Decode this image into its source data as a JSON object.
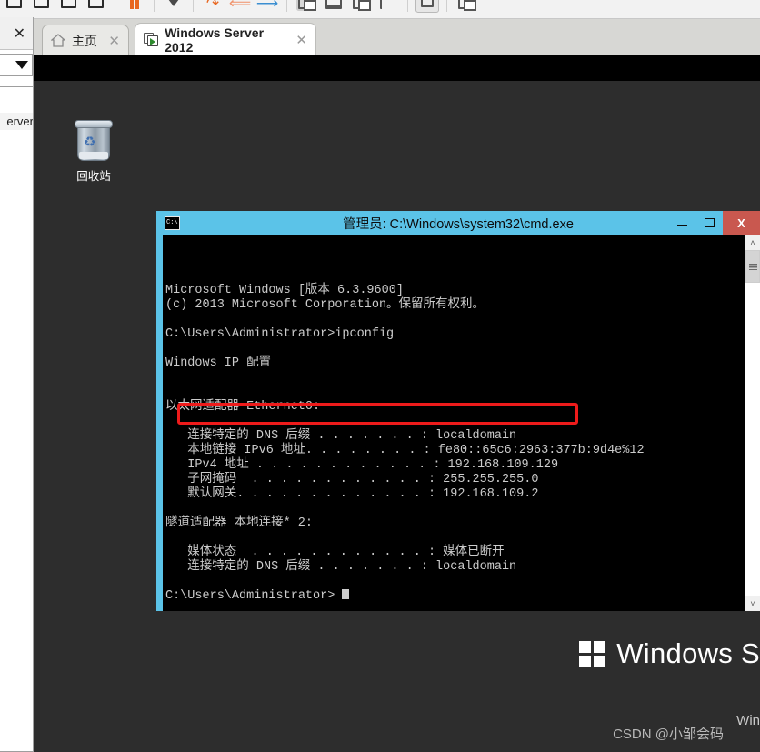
{
  "toolbar": {
    "icons": [
      "screen-icon-1",
      "screen-icon-2",
      "screen-icon-3",
      "screen-icon-4",
      "pause-icon",
      "arrow-down-icon",
      "rotate-icon",
      "back-icon",
      "wrench-icon",
      "layout-single-icon",
      "layout-flat-icon",
      "layout-multi-icon",
      "layout-corner-icon",
      "fullscreen-icon",
      "unity-icon"
    ]
  },
  "tabs": [
    {
      "label": "主页",
      "icon": "home-icon",
      "close": "✕",
      "active": false
    },
    {
      "label": "Windows Server 2012",
      "icon": "vm-play-icon",
      "close": "✕",
      "active": true
    }
  ],
  "left_panel": {
    "close_label": "✕",
    "combo_value": ".",
    "list_item": "erver"
  },
  "desktop": {
    "recycle_bin_label": "回收站",
    "brand_text": "Windows S",
    "activation_watermark": "Win",
    "csdn_watermark": "CSDN @小邹会码"
  },
  "cmd_window": {
    "title": "管理员: C:\\Windows\\system32\\cmd.exe",
    "icon": "cmd-icon",
    "minimize_label": "–",
    "maximize_label": "□",
    "close_label": "X",
    "scroll_up": "˄",
    "scroll_down": "˅",
    "lines": [
      "Microsoft Windows [版本 6.3.9600]",
      "(c) 2013 Microsoft Corporation。保留所有权利。",
      "",
      "C:\\Users\\Administrator>ipconfig",
      "",
      "Windows IP 配置",
      "",
      "",
      "以太网适配器 Ethernet0:",
      "",
      "   连接特定的 DNS 后缀 . . . . . . . : localdomain",
      "   本地链接 IPv6 地址. . . . . . . . : fe80::65c6:2963:377b:9d4e%12",
      "   IPv4 地址 . . . . . . . . . . . . : 192.168.109.129",
      "   子网掩码  . . . . . . . . . . . . : 255.255.255.0",
      "   默认网关. . . . . . . . . . . . . : 192.168.109.2",
      "",
      "隧道适配器 本地连接* 2:",
      "",
      "   媒体状态  . . . . . . . . . . . . : 媒体已断开",
      "   连接特定的 DNS 后缀 . . . . . . . : localdomain",
      "",
      "C:\\Users\\Administrator>"
    ],
    "highlight": {
      "target_line": "IPv4 地址",
      "value": "192.168.109.129",
      "color": "#ee1b1b"
    }
  },
  "colors": {
    "title_bar": "#5bc3e8",
    "close_button": "#c9584f",
    "console_bg": "#000000",
    "console_fg": "#cccccc",
    "desktop_bg": "#2d2d2d",
    "tabbar_bg": "#d7d7d4"
  }
}
